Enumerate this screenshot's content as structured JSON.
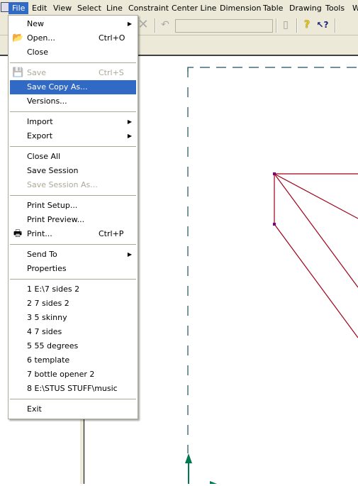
{
  "menubar": {
    "items": [
      {
        "label": "File",
        "active": true
      },
      {
        "label": "Edit"
      },
      {
        "label": "View"
      },
      {
        "label": "Select"
      },
      {
        "label": "Line"
      },
      {
        "label": "Constraint"
      },
      {
        "label": "Center Line"
      },
      {
        "label": "Dimension"
      },
      {
        "label": "Table"
      },
      {
        "label": "Drawing"
      },
      {
        "label": "Tools"
      },
      {
        "label": "W"
      }
    ]
  },
  "toolbar": {
    "icons": [
      "delete-icon",
      "undo-icon",
      "regenerate-icon",
      "help-icon",
      "context-help-icon"
    ],
    "help_glyph": "?",
    "context_help_glyph": "↖?"
  },
  "file_menu": {
    "items": [
      {
        "label": "New",
        "submenu": true
      },
      {
        "label": "Open...",
        "shortcut": "Ctrl+O",
        "icon": "open-folder-icon"
      },
      {
        "label": "Close"
      },
      {
        "separator": true
      },
      {
        "label": "Save",
        "shortcut": "Ctrl+S",
        "icon": "save-disk-icon",
        "disabled": true
      },
      {
        "label": "Save Copy As...",
        "highlighted": true
      },
      {
        "label": "Versions..."
      },
      {
        "separator": true
      },
      {
        "label": "Import",
        "submenu": true
      },
      {
        "label": "Export",
        "submenu": true
      },
      {
        "separator": true
      },
      {
        "label": "Close All"
      },
      {
        "label": "Save Session"
      },
      {
        "label": "Save Session As...",
        "disabled": true
      },
      {
        "separator": true
      },
      {
        "label": "Print Setup..."
      },
      {
        "label": "Print Preview..."
      },
      {
        "label": "Print...",
        "shortcut": "Ctrl+P",
        "icon": "printer-icon"
      },
      {
        "separator": true
      },
      {
        "label": "Send To",
        "submenu": true
      },
      {
        "label": "Properties"
      },
      {
        "separator": true
      },
      {
        "label": "1 E:\\7 sides 2"
      },
      {
        "label": "2 7 sides 2"
      },
      {
        "label": "3 5 skinny"
      },
      {
        "label": "4 7 sides"
      },
      {
        "label": "5 55 degrees"
      },
      {
        "label": "6 template"
      },
      {
        "label": "7 bottle opener 2"
      },
      {
        "label": "8 E:\\STUS STUFF\\music"
      },
      {
        "separator": true
      },
      {
        "label": "Exit"
      }
    ]
  },
  "colors": {
    "highlight": "#316ac5",
    "sketch_line": "#a00018",
    "sketch_point": "#800080",
    "border_dash": "#1f4f5f",
    "axis_arrow": "#007850"
  }
}
